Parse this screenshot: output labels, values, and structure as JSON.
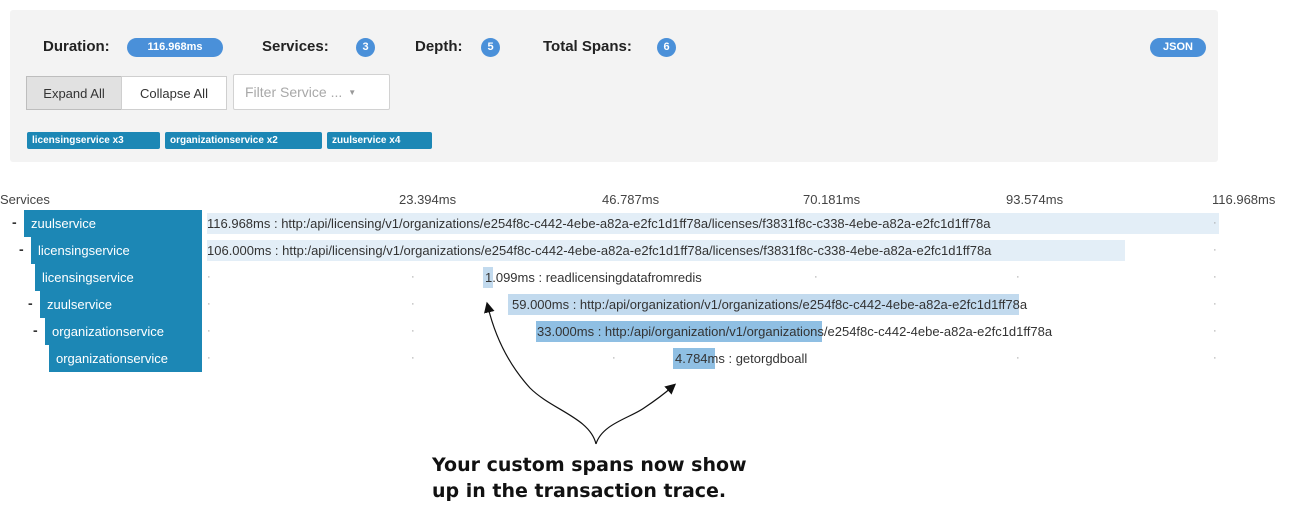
{
  "summary": {
    "duration_label": "Duration:",
    "duration_value": "116.968ms",
    "services_label": "Services:",
    "services_value": "3",
    "depth_label": "Depth:",
    "depth_value": "5",
    "total_spans_label": "Total Spans:",
    "total_spans_value": "6",
    "json_label": "JSON"
  },
  "controls": {
    "expand_all": "Expand All",
    "collapse_all": "Collapse All",
    "filter_placeholder": "Filter Service ..."
  },
  "service_tags": [
    "licensingservice x3",
    "organizationservice x2",
    "zuulservice x4"
  ],
  "timeline": {
    "services_header": "Services",
    "ticks": [
      "23.394ms",
      "46.787ms",
      "70.181ms",
      "93.574ms",
      "116.968ms"
    ]
  },
  "spans": [
    {
      "service": "zuulservice",
      "toggle": "-",
      "label": "116.968ms : http:/api/licensing/v1/organizations/e254f8c-c442-4ebe-a82a-e2fc1d1ff78a/licenses/f3831f8c-c338-4ebe-a82a-e2fc1d1ff78a"
    },
    {
      "service": "licensingservice",
      "toggle": "-",
      "label": "106.000ms : http:/api/licensing/v1/organizations/e254f8c-c442-4ebe-a82a-e2fc1d1ff78a/licenses/f3831f8c-c338-4ebe-a82a-e2fc1d1ff78a"
    },
    {
      "service": "licensingservice",
      "toggle": "",
      "label": "1.099ms : readlicensingdatafromredis"
    },
    {
      "service": "zuulservice",
      "toggle": "-",
      "label": "59.000ms : http:/api/organization/v1/organizations/e254f8c-c442-4ebe-a82a-e2fc1d1ff78a"
    },
    {
      "service": "organizationservice",
      "toggle": "-",
      "label": "33.000ms : http:/api/organization/v1/organizations/e254f8c-c442-4ebe-a82a-e2fc1d1ff78a"
    },
    {
      "service": "organizationservice",
      "toggle": "",
      "label": "4.784ms : getorgdboall"
    }
  ],
  "annotation": "Your custom spans now show\nup in the transaction trace.",
  "colors": {
    "service_bg": "#1c87b5",
    "pill_bg": "#4a90d9",
    "bar_light": "#e3eef7",
    "bar_mid": "#c2daee",
    "bar_dark": "#8fbfe3"
  }
}
